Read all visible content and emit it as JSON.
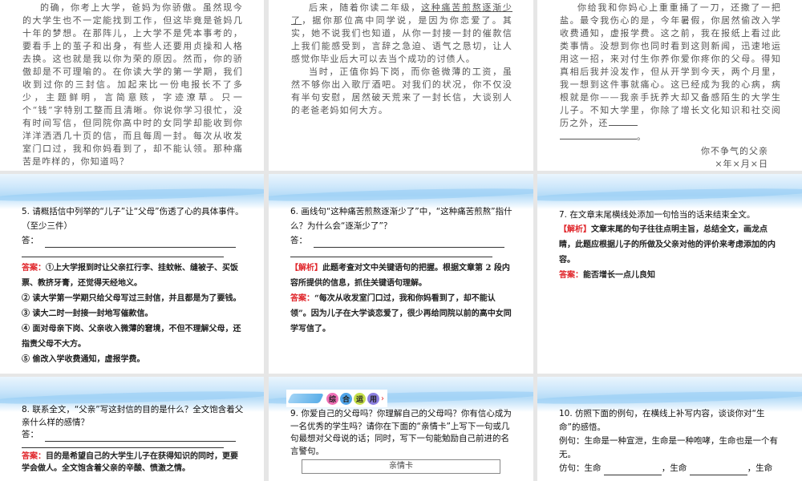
{
  "slide1": {
    "paragraphs": [
      "的确，你考上大学，爸妈为你骄傲。虽然现今的大学生也不一定能找到工作，但这毕竟是爸妈几十年的梦想。在那阵儿，上大学不是凭本事考的，要看手上的茧子和出身，有些人还要用贞操和人格去换。这也就是我以你为荣的原因。然而，你的骄傲却是不可理喻的。在你读大学的第一学期，我们收到过你的三封信。加起来比一份电报长不了多少，主题鲜明，言简意赅，字迹潦草。只一个“钱”字特别工整而且清晰。你说你学习很忙，没有时间写信，但同院你高中时的女同学却能收到你洋洋洒洒几十页的信，而且每周一封。每次从收发室门口过，我和你妈看到了，却不能认领。那种痛苦是咋样的，你知道吗？"
    ]
  },
  "slide2": {
    "p1_before": "后来，随着你读二年级，",
    "p1_underlined": "这种痛苦煎熬逐渐少了",
    "p1_after": "，据你那位高中同学说，是因为你恋爱了。其实，她不说我们也知道，从你一封接一封的催款信上我们能感受到，言辞之急迫、语气之恳切，让人感觉你毕业后大可以去当个成功的讨债人。",
    "p2": "当时，正值你妈下岗，而你爸微薄的工资，虽然不够你出入歌厅酒吧。对我们的状况，你不仅没有半句安慰，居然破天荒来了一封长信，大谈别人的老爸老妈如何大方。"
  },
  "slide3": {
    "paragraph": "你给我和你妈心上重重捅了一刀，还撒了一把盐。最令我伤心的是，今年暑假，你居然偷改入学收费通知，虚报学费。这之前，我在报纸上看过此类事情。没想到你也同时看到这则新闻，迅速地运用这一招，来对付生你养你爱你疼你的父母。得知真相后我并没发作，但从开学到今天，两个月里，我一想到这件事就痛心。这已经成为我的心病，病根就是你——我亲手抚养大却又备感陌生的大学生儿子。不知大学里，你除了增长文化知识和社交阅历之外，还",
    "end_mark": "。",
    "signature": "你不争气的父亲",
    "date": "×年×月×日"
  },
  "slide4": {
    "question": "5. 请概括信中列举的“儿子”让“父母”伤透了心的具体事件。（至少三件）",
    "answer_prompt": "答：",
    "answer_label": "答案：",
    "answers": [
      "①上大学报到时让父亲扛行李、挂蚊帐、缝被子、买饭票、教挤牙膏，还觉得天经地义。",
      "② 读大学第一学期只给父母写过三封信，并且都是为了要钱。",
      "③ 读大二时一封接一封地写催款信。",
      "④ 面对母亲下岗、父亲收入微薄的窘境，不但不理解父母，还指责父母不大方。",
      "⑤ 偷改入学收费通知，虚报学费。"
    ]
  },
  "slide5": {
    "question": "6. 画线句“这种痛苦煎熬逐渐少了”中，“这种痛苦煎熬”指什么？为什么会“逐渐少了”？",
    "answer_prompt": "答：",
    "analysis_label": "【解析】",
    "analysis": "此题考查对文中关键语句的把握。根据文章第 2 段内容所提供的信息，抓住关键语句理解。",
    "answer_label": "答案：",
    "answer": "“每次从收发室门口过，我和你妈看到了，却不能认领”。因为儿子在大学谈恋爱了，很少再给同院以前的高中女同学写信了。"
  },
  "slide6": {
    "question": "7. 在文章末尾横线处添加一句恰当的话来结束全文。",
    "analysis_label": "【解析】",
    "analysis": "文章末尾的句子往往点明主旨，总结全文，画龙点睛，此题应根据儿子的所做及父亲对他的评价来考虑添加的内容。",
    "answer_label": "答案：",
    "answer": "能否增长一点儿良知"
  },
  "slide7": {
    "question": "8. 联系全文，“父亲”写这封信的目的是什么？全文饱含着父亲什么样的感情？",
    "answer_prompt": "答：",
    "answer_label": "答案：",
    "answer": "目的是希望自己的大学生儿子在获得知识的同时，更要学会做人。全文饱含着父亲的辛酸、愤激之情。"
  },
  "slide8": {
    "badge": [
      "综",
      "合",
      "运",
      "用"
    ],
    "badge_colors": [
      "#f06fb6",
      "#4fa3e8",
      "#c6e04a",
      "#8b7fe0"
    ],
    "question": "9. 你爱自己的父母吗？你理解自己的父母吗？你有信心成为一名优秀的学生吗？请你在下面的“亲情卡”上写下一句或几句最想对父母说的话；同时，写下一句能勉励自己前进的名言警句。",
    "card_title": "亲情卡"
  },
  "slide9": {
    "question": "10. 仿照下面的例句，在横线上补写内容，谈谈你对“生命”的感悟。",
    "example": "例句：生命是一种宣泄，生命是一种咆哮，生命也是一个有无。",
    "imitate_label": "仿句：生命",
    "comma_life": "，生命",
    "end": "。"
  }
}
